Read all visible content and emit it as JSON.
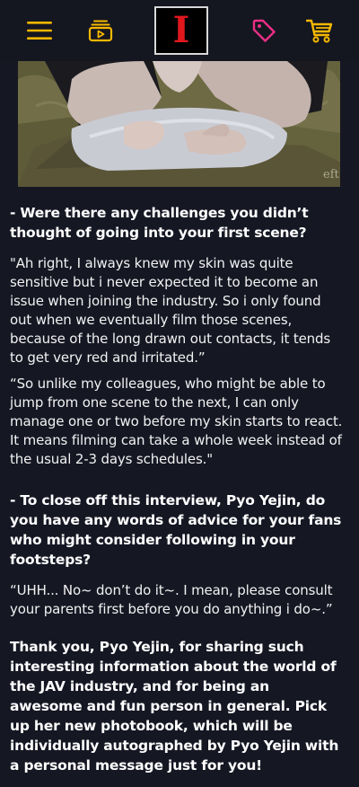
{
  "header": {
    "menu_icon": "hamburger-menu-icon",
    "video_icon": "video-playlist-icon",
    "logo_letter": "I",
    "tag_icon": "price-tag-icon",
    "cart_icon": "shopping-cart-icon",
    "accent_yellow": "#f5b800",
    "accent_pink": "#ea2f86",
    "logo_red": "#e0181e"
  },
  "photo": {
    "watermark": "eft"
  },
  "article": {
    "q1": "- Were there any challenges you didn’t thought of going into your first scene?",
    "a1": "\"Ah right, I always knew my skin was quite sensitive but i never expected it to become an issue when joining the industry. So i only found out when we eventually film those scenes, because of the long drawn out contacts, it tends to get very red and irritated.”",
    "a2": "“So unlike my colleagues, who might be able to jump from one scene to the next, I can only manage one or two before my skin starts to react. It means filming can take a whole week instead of the usual 2-3 days schedules.\"",
    "q2": "- To close off this interview, Pyo Yejin, do you have any words of advice for your fans who might consider following in your footsteps?",
    "a3": "“UHH... No~ don’t do it~. I mean, please consult your parents first before you do anything i do~.”",
    "closing": "Thank you, Pyo Yejin, for sharing such interesting information about the world of the JAV industry, and for being an awesome and fun person in general. Pick up her new photobook, which will be individually autographed by Pyo Yejin with a personal message just for you!"
  }
}
